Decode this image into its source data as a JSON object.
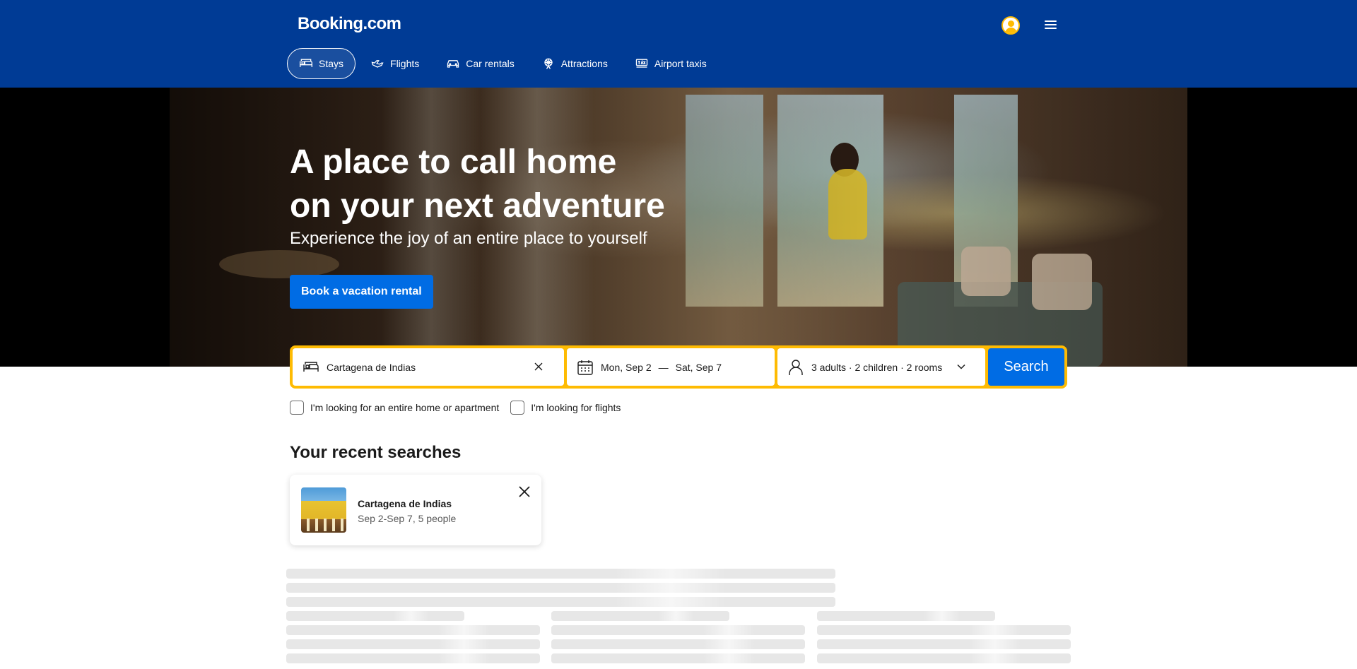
{
  "header": {
    "logo": "Booking.com",
    "nav": [
      {
        "label": "Stays",
        "icon": "bed-icon",
        "active": true
      },
      {
        "label": "Flights",
        "icon": "airplane-icon"
      },
      {
        "label": "Car rentals",
        "icon": "car-icon"
      },
      {
        "label": "Attractions",
        "icon": "ferris-wheel-icon"
      },
      {
        "label": "Airport taxis",
        "icon": "taxi-icon"
      }
    ]
  },
  "hero": {
    "title_line1": "A place to call home",
    "title_line2": "on your next adventure",
    "subtitle": "Experience the joy of an entire place to yourself",
    "cta": "Book a vacation rental"
  },
  "search": {
    "destination": "Cartagena de Indias",
    "checkin": "Mon, Sep 2",
    "date_separator": "—",
    "checkout": "Sat, Sep 7",
    "guests": "3 adults · 2 children · 2 rooms",
    "button": "Search"
  },
  "options": {
    "entire_home": "I'm looking for an entire home or apartment",
    "flights": "I'm looking for flights"
  },
  "recent": {
    "title": "Your recent searches",
    "items": [
      {
        "title": "Cartagena de Indias",
        "subtitle": "Sep 2-Sep 7, 5 people"
      }
    ]
  },
  "colors": {
    "brand_blue": "#003b95",
    "action_blue": "#006ce4",
    "search_border": "#febb02"
  }
}
